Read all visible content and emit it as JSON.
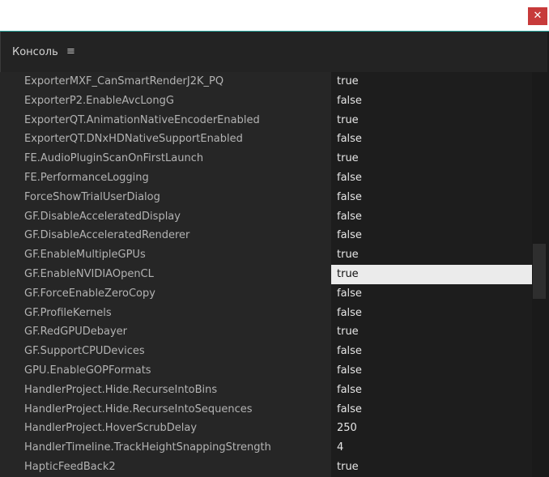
{
  "window": {
    "close_label": "✕"
  },
  "panel": {
    "title": "Консоль",
    "menu_icon": "≡"
  },
  "rows": [
    {
      "key": "ExporterMXF_CanSmartRenderJ2K_PQ",
      "value": "true"
    },
    {
      "key": "ExporterP2.EnableAvcLongG",
      "value": "false"
    },
    {
      "key": "ExporterQT.AnimationNativeEncoderEnabled",
      "value": "true"
    },
    {
      "key": "ExporterQT.DNxHDNativeSupportEnabled",
      "value": "false"
    },
    {
      "key": "FE.AudioPluginScanOnFirstLaunch",
      "value": "true"
    },
    {
      "key": "FE.PerformanceLogging",
      "value": "false"
    },
    {
      "key": "ForceShowTrialUserDialog",
      "value": "false"
    },
    {
      "key": "GF.DisableAcceleratedDisplay",
      "value": "false"
    },
    {
      "key": "GF.DisableAcceleratedRenderer",
      "value": "false"
    },
    {
      "key": "GF.EnableMultipleGPUs",
      "value": "true"
    },
    {
      "key": "GF.EnableNVIDIAOpenCL",
      "value": "true",
      "selected": true
    },
    {
      "key": "GF.ForceEnableZeroCopy",
      "value": "false"
    },
    {
      "key": "GF.ProfileKernels",
      "value": "false"
    },
    {
      "key": "GF.RedGPUDebayer",
      "value": "true"
    },
    {
      "key": "GF.SupportCPUDevices",
      "value": "false"
    },
    {
      "key": "GPU.EnableGOPFormats",
      "value": "false"
    },
    {
      "key": "HandlerProject.Hide.RecurseIntoBins",
      "value": "false"
    },
    {
      "key": "HandlerProject.Hide.RecurseIntoSequences",
      "value": "false"
    },
    {
      "key": "HandlerProject.HoverScrubDelay",
      "value": "250"
    },
    {
      "key": "HandlerTimeline.TrackHeightSnappingStrength",
      "value": "4"
    },
    {
      "key": "HapticFeedBack2",
      "value": "true"
    }
  ],
  "colors": {
    "accent_border": "#2aa8a0",
    "close_bg": "#c73a3a",
    "selected_bg": "#ebebeb"
  }
}
